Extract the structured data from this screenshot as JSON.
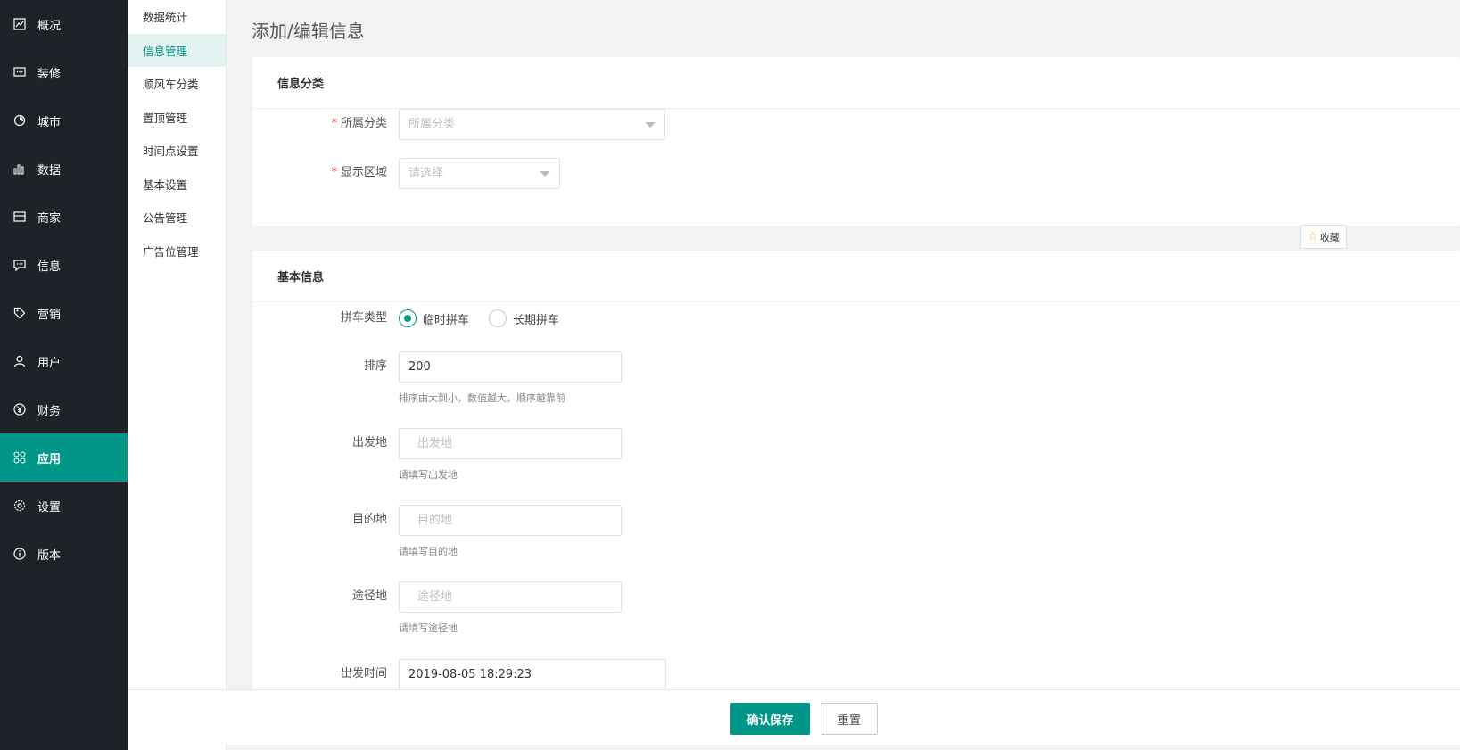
{
  "sidebar": {
    "items": [
      {
        "label": "概况",
        "icon": "overview-icon"
      },
      {
        "label": "装修",
        "icon": "decoration-icon"
      },
      {
        "label": "城市",
        "icon": "city-icon"
      },
      {
        "label": "数据",
        "icon": "chart-icon"
      },
      {
        "label": "商家",
        "icon": "store-icon"
      },
      {
        "label": "信息",
        "icon": "message-icon"
      },
      {
        "label": "营销",
        "icon": "tag-icon"
      },
      {
        "label": "用户",
        "icon": "user-icon"
      },
      {
        "label": "财务",
        "icon": "yen-icon"
      },
      {
        "label": "应用",
        "icon": "apps-icon",
        "active": true
      },
      {
        "label": "设置",
        "icon": "gear-icon"
      },
      {
        "label": "版本",
        "icon": "info-icon"
      }
    ],
    "active_color": "#009688"
  },
  "submenu": {
    "items": [
      {
        "label": "数据统计"
      },
      {
        "label": "信息管理",
        "active": true
      },
      {
        "label": "顺风车分类"
      },
      {
        "label": "置顶管理"
      },
      {
        "label": "时间点设置"
      },
      {
        "label": "基本设置"
      },
      {
        "label": "公告管理"
      },
      {
        "label": "广告位管理"
      }
    ]
  },
  "page": {
    "title": "添加/编辑信息"
  },
  "category_card": {
    "title": "信息分类",
    "fields": {
      "category": {
        "label": "所属分类",
        "placeholder": "所属分类",
        "required": true
      },
      "region": {
        "label": "显示区域",
        "placeholder": "请选择",
        "required": true
      }
    }
  },
  "favorite": {
    "label": "收藏"
  },
  "basic_card": {
    "title": "基本信息",
    "carpool_type": {
      "label": "拼车类型",
      "options": [
        {
          "label": "临时拼车",
          "selected": true
        },
        {
          "label": "长期拼车",
          "selected": false
        }
      ]
    },
    "sort": {
      "label": "排序",
      "value": "200",
      "hint": "排序由大到小，数值越大，顺序越靠前"
    },
    "departure": {
      "label": "出发地",
      "placeholder": "出发地",
      "hint": "请填写出发地"
    },
    "destination": {
      "label": "目的地",
      "placeholder": "目的地",
      "hint": "请填写目的地"
    },
    "via": {
      "label": "途径地",
      "placeholder": "途径地",
      "hint": "请填写途径地"
    },
    "depart_time": {
      "label": "出发时间",
      "value": "2019-08-05 18:29:23"
    }
  },
  "footer": {
    "save_label": "确认保存",
    "reset_label": "重置"
  }
}
